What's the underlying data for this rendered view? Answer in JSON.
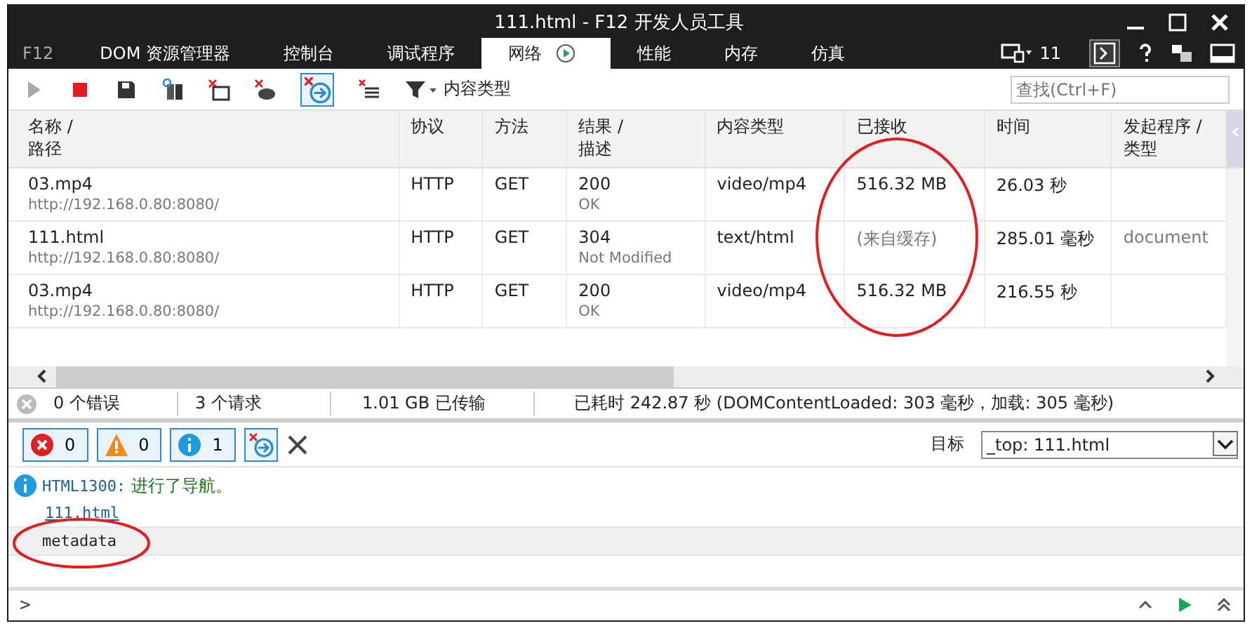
{
  "window": {
    "title": "111.html - F12 开发人员工具"
  },
  "app_label": "F12",
  "tabs": [
    {
      "label": "DOM 资源管理器",
      "selected": false
    },
    {
      "label": "控制台",
      "selected": false
    },
    {
      "label": "调试程序",
      "selected": false
    },
    {
      "label": "网络",
      "selected": true,
      "recording": true
    },
    {
      "label": "性能",
      "selected": false
    },
    {
      "label": "内存",
      "selected": false
    },
    {
      "label": "仿真",
      "selected": false
    }
  ],
  "browser_mode": {
    "version": "11"
  },
  "toolbar": {
    "filter_label": "内容类型",
    "search": {
      "placeholder": "查找(Ctrl+F)"
    },
    "clear_on_navigate": true
  },
  "table": {
    "columns": [
      {
        "label": "名称 /\n路径",
        "circled": false
      },
      {
        "label": "协议",
        "circled": false
      },
      {
        "label": "方法",
        "circled": false
      },
      {
        "label": "结果 /\n描述",
        "circled": false
      },
      {
        "label": "内容类型",
        "circled": false
      },
      {
        "label": "已接收",
        "circled": true
      },
      {
        "label": "时间",
        "circled": false
      },
      {
        "label": "发起程序 /\n类型",
        "circled": false
      }
    ],
    "rows": [
      {
        "name": "03.mp4",
        "path": "http://192.168.0.80:8080/",
        "protocol": "HTTP",
        "method": "GET",
        "result": "200",
        "description": "OK",
        "content_type": "video/mp4",
        "received": "516.32 MB",
        "from_cache": false,
        "time": "26.03 秒",
        "initiator": ""
      },
      {
        "name": "111.html",
        "path": "http://192.168.0.80:8080/",
        "protocol": "HTTP",
        "method": "GET",
        "result": "304",
        "description": "Not Modified",
        "content_type": "text/html",
        "received": "(来自缓存)",
        "from_cache": true,
        "time": "285.01 毫秒",
        "initiator": "document"
      },
      {
        "name": "03.mp4",
        "path": "http://192.168.0.80:8080/",
        "protocol": "HTTP",
        "method": "GET",
        "result": "200",
        "description": "OK",
        "content_type": "video/mp4",
        "received": "516.32 MB",
        "from_cache": false,
        "time": "216.55 秒",
        "initiator": ""
      }
    ]
  },
  "summary": {
    "errors": "0 个错误",
    "requests": "3 个请求",
    "transferred": "1.01 GB 已传输",
    "elapsed": "已耗时 242.87 秒 (DOMContentLoaded: 303 毫秒，加载: 305 毫秒)"
  },
  "console": {
    "filters": [
      {
        "kind": "error",
        "count": "0"
      },
      {
        "kind": "warning",
        "count": "0"
      },
      {
        "kind": "info",
        "count": "1"
      }
    ],
    "target_label": "目标",
    "target_value": "_top: 111.html",
    "messages": [
      {
        "kind": "info",
        "code": "HTML1300:",
        "text": "进行了导航。",
        "circled": false
      },
      {
        "kind": "link",
        "text": "111.html",
        "circled": false
      },
      {
        "kind": "object",
        "text": "metadata",
        "circled": true
      }
    ],
    "prompt": ">"
  }
}
